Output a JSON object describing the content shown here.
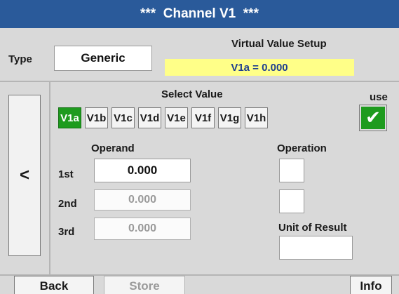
{
  "header": {
    "title": "***  Channel V1  ***"
  },
  "type_section": {
    "label": "Type",
    "value": "Generic"
  },
  "virtual_setup": {
    "title": "Virtual Value Setup",
    "result": "V1a = 0.000",
    "highlight_color": "#ffff88"
  },
  "nav": {
    "back_arrow": "<"
  },
  "select_value": {
    "label": "Select Value",
    "buttons": [
      "V1a",
      "V1b",
      "V1c",
      "V1d",
      "V1e",
      "V1f",
      "V1g",
      "V1h"
    ],
    "active": "V1a"
  },
  "use": {
    "label": "use",
    "checked": true,
    "check_glyph": "✔",
    "color": "#1e9b1e"
  },
  "operand": {
    "label": "Operand",
    "rows": [
      {
        "label": "1st",
        "value": "0.000",
        "enabled": true
      },
      {
        "label": "2nd",
        "value": "0.000",
        "enabled": false
      },
      {
        "label": "3rd",
        "value": "0.000",
        "enabled": false
      }
    ]
  },
  "operation": {
    "label": "Operation"
  },
  "unit_of_result": {
    "label": "Unit of Result",
    "value": ""
  },
  "footer": {
    "back": "Back",
    "store": "Store",
    "info": "Info"
  },
  "colors": {
    "header": "#2a5a9a",
    "panel": "#d9d9d9",
    "active_green": "#1e9b1e"
  }
}
